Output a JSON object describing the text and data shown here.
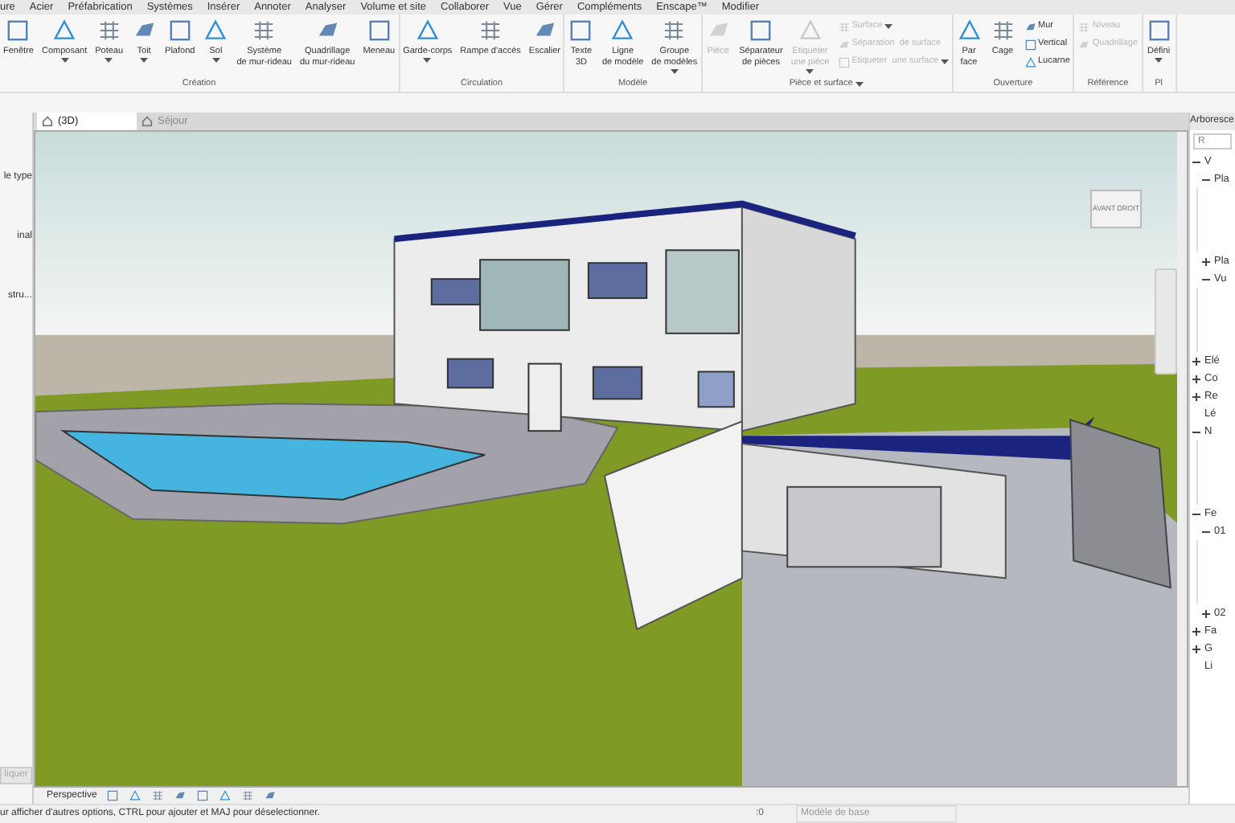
{
  "menu": [
    "ure",
    "Acier",
    "Préfabrication",
    "Systèmes",
    "Insérer",
    "Annoter",
    "Analyser",
    "Volume et site",
    "Collaborer",
    "Vue",
    "Gérer",
    "Compléments",
    "Enscape™",
    "Modifier"
  ],
  "ribbon": {
    "groups": [
      {
        "label": "Création",
        "has_menu": false,
        "tools": [
          {
            "kind": "large",
            "label": "Fenêtre",
            "caret": false,
            "disabled": false
          },
          {
            "kind": "large",
            "label": "Composant",
            "caret": true,
            "disabled": false
          },
          {
            "kind": "large",
            "label": "Poteau",
            "caret": true,
            "disabled": false
          },
          {
            "kind": "large",
            "label": "Toit",
            "caret": true,
            "disabled": false
          },
          {
            "kind": "large",
            "label": "Plafond",
            "caret": false,
            "disabled": false
          },
          {
            "kind": "large",
            "label": "Sol",
            "caret": true,
            "disabled": false
          },
          {
            "kind": "large",
            "label": "Système\nde mur-rideau",
            "caret": false,
            "disabled": false
          },
          {
            "kind": "large",
            "label": "Quadrillage\ndu mur-rideau",
            "caret": false,
            "disabled": false
          },
          {
            "kind": "large",
            "label": "Meneau",
            "caret": false,
            "disabled": false
          }
        ]
      },
      {
        "label": "Circulation",
        "has_menu": false,
        "tools": [
          {
            "kind": "large",
            "label": "Garde-corps",
            "caret": true,
            "disabled": false
          },
          {
            "kind": "large",
            "label": "Rampe d'accès",
            "caret": false,
            "disabled": false
          },
          {
            "kind": "large",
            "label": "Escalier",
            "caret": false,
            "disabled": false
          }
        ]
      },
      {
        "label": "Modèle",
        "has_menu": false,
        "tools": [
          {
            "kind": "large",
            "label": "Texte\n3D",
            "caret": false,
            "disabled": false
          },
          {
            "kind": "large",
            "label": "Ligne\nde modèle",
            "caret": false,
            "disabled": false
          },
          {
            "kind": "large",
            "label": "Groupe\nde modèles",
            "caret": true,
            "disabled": false
          }
        ]
      },
      {
        "label": "Pièce et surface",
        "has_menu": true,
        "tools": [
          {
            "kind": "large",
            "label": "Pièce",
            "caret": false,
            "disabled": true
          },
          {
            "kind": "large",
            "label": "Séparateur\nde pièces",
            "caret": false,
            "disabled": false
          },
          {
            "kind": "large",
            "label": "Etiqueter\nune pièce",
            "caret": true,
            "disabled": true
          },
          {
            "kind": "stack",
            "items": [
              {
                "label": "Surface",
                "caret": true,
                "disabled": true
              },
              {
                "label": "Séparation  de surface",
                "caret": false,
                "disabled": true
              },
              {
                "label": "Etiqueter  une surface",
                "caret": true,
                "disabled": true
              }
            ]
          }
        ]
      },
      {
        "label": "Ouverture",
        "has_menu": false,
        "tools": [
          {
            "kind": "large",
            "label": "Par\nface",
            "caret": false,
            "disabled": false
          },
          {
            "kind": "large",
            "label": "Cage",
            "caret": false,
            "disabled": false
          },
          {
            "kind": "stack",
            "items": [
              {
                "label": "Mur",
                "caret": false,
                "disabled": false
              },
              {
                "label": "Vertical",
                "caret": false,
                "disabled": false
              },
              {
                "label": "Lucarne",
                "caret": false,
                "disabled": false
              }
            ]
          }
        ]
      },
      {
        "label": "Référence",
        "has_menu": false,
        "tools": [
          {
            "kind": "stack",
            "items": [
              {
                "label": "Niveau",
                "caret": false,
                "disabled": true
              },
              {
                "label": "Quadrillage",
                "caret": false,
                "disabled": true
              }
            ]
          }
        ]
      },
      {
        "label": "Pl",
        "has_menu": false,
        "tools": [
          {
            "kind": "large",
            "label": "Défini",
            "caret": true,
            "disabled": false
          }
        ]
      }
    ]
  },
  "properties": {
    "texts": [
      "le type",
      "inal",
      "stru..."
    ],
    "apply_button": "liquer"
  },
  "tabs": [
    {
      "label": "(3D)",
      "selected": true
    },
    {
      "label": "Séjour",
      "selected": false
    }
  ],
  "viewcube": {
    "front": "AVANT",
    "right": "DROIT"
  },
  "view_bar": {
    "label": "Perspective"
  },
  "browser": {
    "title": "Arboresce",
    "search_placeholder": "R",
    "tree": [
      {
        "label": "V",
        "expanded": true,
        "children": [
          {
            "label": "Pla",
            "expanded": true
          },
          {
            "label": "Pla",
            "expanded": false
          },
          {
            "label": "Vu",
            "expanded": true
          }
        ]
      },
      {
        "label": "Elé",
        "expanded": false
      },
      {
        "label": "Co",
        "expanded": false
      },
      {
        "label": "Re",
        "expanded": false
      },
      {
        "label": "Lé"
      },
      {
        "label": "N",
        "expanded": true
      },
      {
        "label": "Fe",
        "expanded": true,
        "children": [
          {
            "label": "01",
            "expanded": true
          },
          {
            "label": "02",
            "expanded": false
          }
        ]
      },
      {
        "label": "Fa",
        "expanded": false
      },
      {
        "label": "G",
        "expanded": false
      },
      {
        "label": "Li"
      }
    ]
  },
  "status_bar": {
    "message": "ur afficher d'autres options,  CTRL pour ajouter et MAJ pour déselectionner.",
    "count": ":0",
    "model": "Modèle de base"
  }
}
